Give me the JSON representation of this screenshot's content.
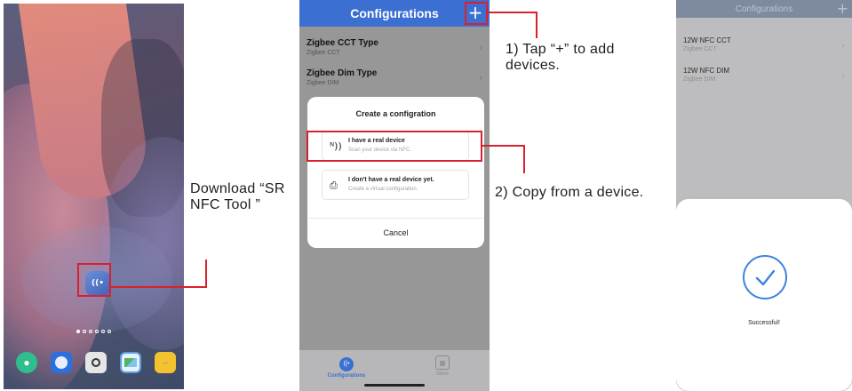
{
  "home_screen": {
    "app_icon_label": "((•",
    "dock_icons": [
      "chat-icon",
      "browser-icon",
      "camera-icon",
      "gallery-icon",
      "notes-icon"
    ],
    "page_dots": 6
  },
  "configurations_screen": {
    "title": "Configurations",
    "add_button": "+",
    "items": [
      {
        "name": "Zigbee CCT Type",
        "subtitle": "Zigbee CCT"
      },
      {
        "name": "Zigbee Dim Type",
        "subtitle": "Zigbee DIM"
      }
    ],
    "dialog": {
      "title": "Create a configration",
      "options": [
        {
          "icon": "nfc-icon",
          "glyph": "ᴺ))",
          "title": "I have a real device",
          "subtitle": "Scan your device via NFC."
        },
        {
          "icon": "document-icon",
          "glyph": "⎙",
          "title": "I don't have a real device yet.",
          "subtitle": "Create a virtual configuration."
        }
      ],
      "cancel": "Cancel"
    },
    "tabs": [
      {
        "label": "Configurations",
        "icon": "config-icon",
        "active": true
      },
      {
        "label": "More",
        "icon": "grid-icon",
        "active": false
      }
    ]
  },
  "success_screen": {
    "title": "Configurations",
    "add_button": "+",
    "items": [
      {
        "name": "12W NFC CCT",
        "subtitle": "Zigbee CCT"
      },
      {
        "name": "12W NFC DIM",
        "subtitle": "Zigbee DIM"
      }
    ],
    "message": "Successful!"
  },
  "annotations": {
    "download": "Download “SR NFC Tool ”",
    "step1": "1) Tap “+” to add devices.",
    "step2": "2) Copy from a device."
  },
  "colors": {
    "accent": "#3b6fd1",
    "highlight": "#d9202e",
    "success": "#3b82e0"
  }
}
